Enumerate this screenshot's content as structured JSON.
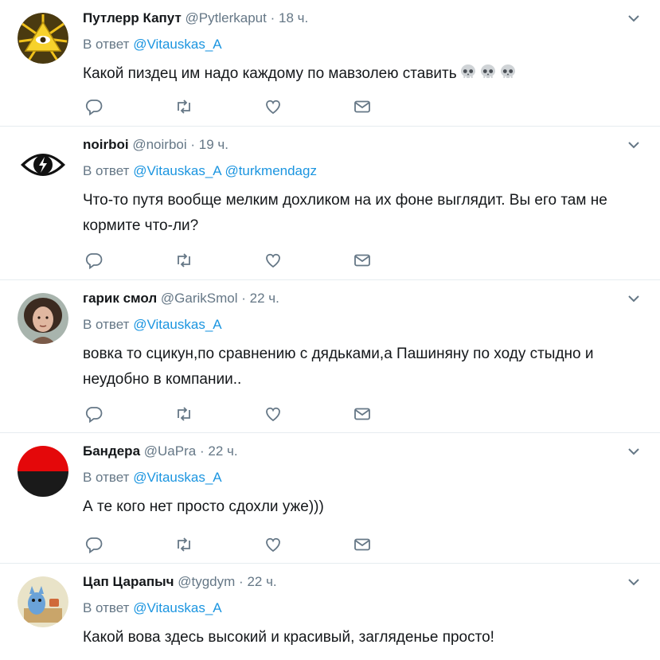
{
  "reply_prefix": "В ответ",
  "tweets": [
    {
      "name": "Путлерр Капут",
      "handle": "@Pytlerkaput",
      "time": "18 ч.",
      "reply_to": [
        "@Vitauskas_A"
      ],
      "text": "Какой пиздец им надо каждому по мавзолею ставить",
      "emoji": [
        "skull",
        "skull",
        "skull"
      ],
      "avatar": "illuminati-eye-pyramid"
    },
    {
      "name": "noirboi",
      "handle": "@noirboi",
      "time": "19 ч.",
      "reply_to": [
        "@Vitauskas_A",
        "@turkmendagz"
      ],
      "text": "Что-то путя вообще мелким дохликом на их фоне выглядит. Вы его там не кормите что-ли?",
      "avatar": "eye-lightning"
    },
    {
      "name": "гарик смол",
      "handle": "@GarikSmol",
      "time": "22 ч.",
      "reply_to": [
        "@Vitauskas_A"
      ],
      "text": "вовка то сцикун,по сравнению с дядьками,а Пашиняну по ходу стыдно и неудобно в компании..",
      "avatar": "portrait"
    },
    {
      "name": "Бандера",
      "handle": "@UaPra",
      "time": "22 ч.",
      "reply_to": [
        "@Vitauskas_A"
      ],
      "text": "А те кого нет просто сдохли уже)))",
      "avatar": "red-black-flag"
    },
    {
      "name": "Цап Царапыч",
      "handle": "@tygdym",
      "time": "22 ч.",
      "reply_to": [
        "@Vitauskas_A"
      ],
      "text": "Какой вова здесь высокий и красивый, загляденье просто!",
      "avatar": "cartoon-cat"
    }
  ],
  "colors": {
    "link": "#1b95e0",
    "muted": "#657786",
    "icon": "#657786",
    "border": "#e6ecf0"
  }
}
